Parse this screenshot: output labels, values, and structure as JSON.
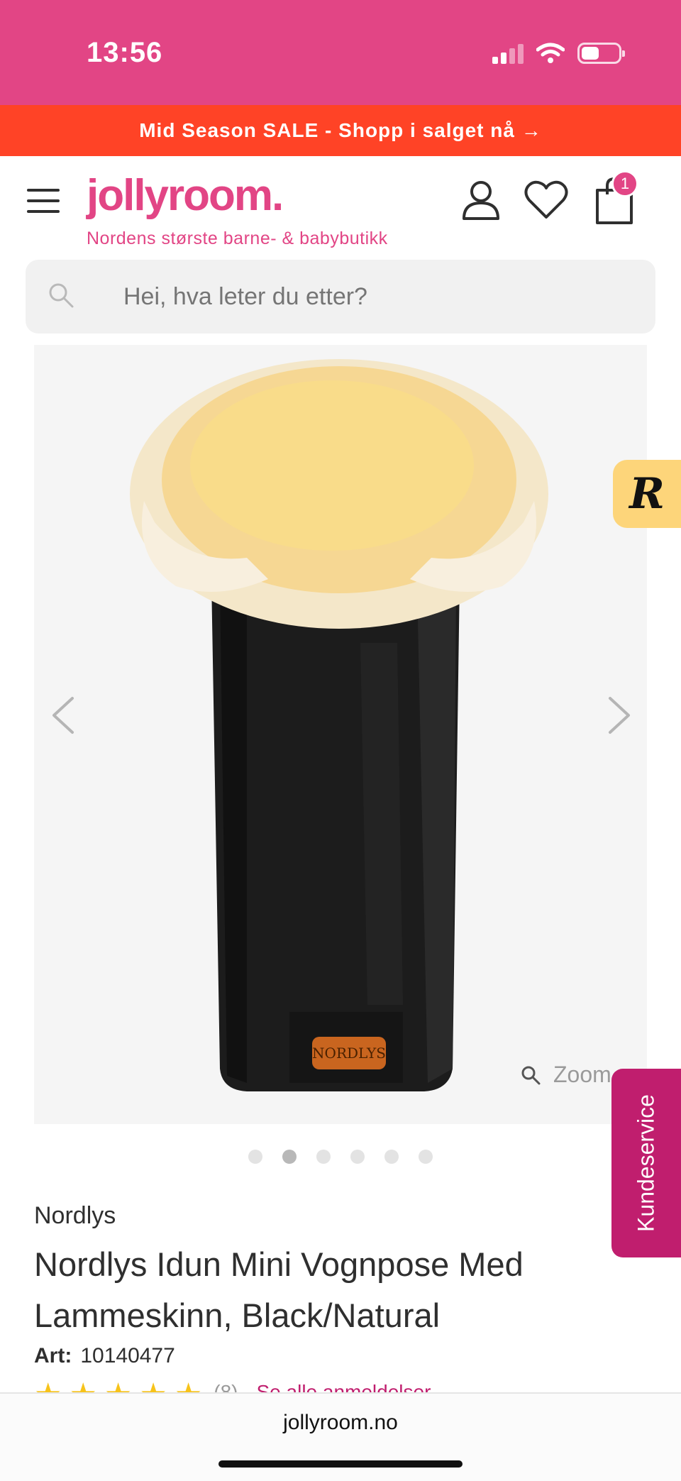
{
  "status_bar": {
    "time": "13:56"
  },
  "promo": {
    "text": "Mid Season SALE - Shopp i salget nå →"
  },
  "header": {
    "logo": "jollyroom.",
    "tagline": "Nordens største barne- & babybutikk",
    "cart_count": "1"
  },
  "search": {
    "placeholder": "Hei, hva leter du etter?"
  },
  "gallery": {
    "zoom_label": "Zoom",
    "dots_total": 6,
    "active_dot": 2,
    "badge_letter": "NORDLYS"
  },
  "floating": {
    "r_badge": "R",
    "customer_service": "Kundeservice"
  },
  "product": {
    "brand": "Nordlys",
    "title": "Nordlys Idun Mini Vognpose Med Lammeskinn, Black/Natural",
    "art_label": "Art:",
    "art_number": "10140477",
    "rating_stars": 5,
    "review_count": "(8)",
    "reviews_link": "Se alle anmeldelser"
  },
  "browser": {
    "url": "jollyroom.no"
  },
  "colors": {
    "brand_pink": "#e24585",
    "promo_red": "#ff4326",
    "service_magenta": "#c01e6e",
    "star_yellow": "#f7c31a"
  }
}
